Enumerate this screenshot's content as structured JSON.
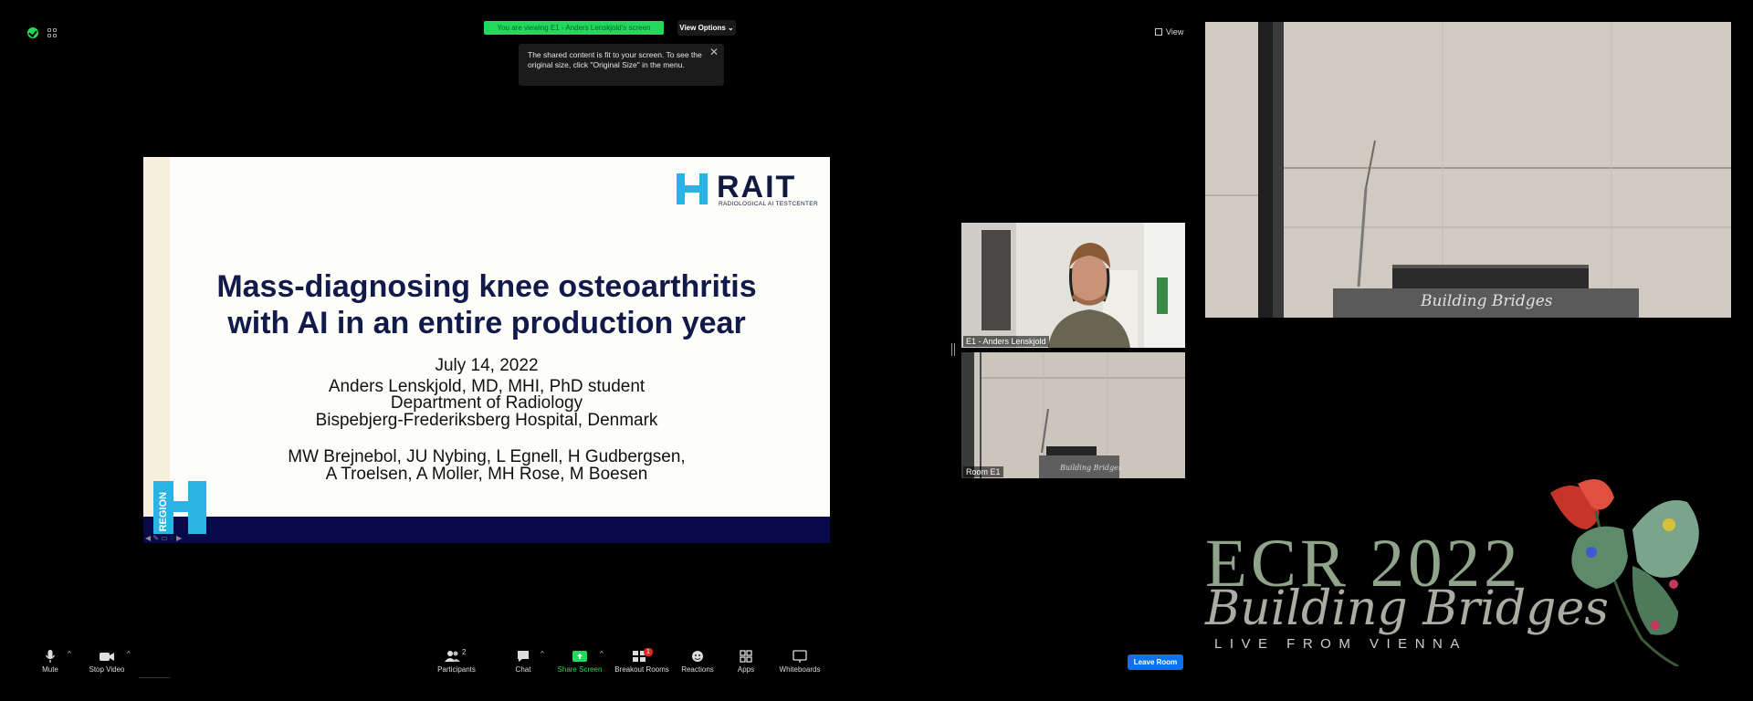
{
  "top_bar": {
    "viewing_banner": "You are viewing E1 - Anders Lenskjold's screen",
    "view_options": "View Options",
    "view_options_caret": "⌄",
    "view_button": "View"
  },
  "fit_notice": {
    "text": "The shared content is fit to your screen. To see the original size, click \"Original Size\" in the menu.",
    "close": "✕"
  },
  "slide": {
    "logo_word": "RAIT",
    "logo_subtitle": "RADIOLOGICAL AI TESTCENTER",
    "title_line1": "Mass-diagnosing knee osteoarthritis",
    "title_line2": "with AI in an entire production year",
    "date": "July 14, 2022",
    "presenter": "Anders Lenskjold, MD, MHI, PhD student",
    "department": "Department of Radiology",
    "hospital": "Bispebjerg-Frederiksberg Hospital, Denmark",
    "authors_line1": "MW Brejnebol, JU Nybing, L Egnell, H Gudbergsen,",
    "authors_line2": "A Troelsen, A Moller, MH Rose, M Boesen",
    "region_label": "REGION",
    "controls": "◀ ✎ ▭ ◌ ▶"
  },
  "video": {
    "speaker_label": "E1 - Anders Lenskjold",
    "room_label": "Room E1",
    "podium_text": "Building Bridges"
  },
  "branding": {
    "ecr_title": "ECR 2022",
    "ecr_subtitle": "Building Bridges",
    "ecr_live": "LIVE FROM VIENNA"
  },
  "toolbar": {
    "mute": "Mute",
    "stop_video": "Stop Video",
    "participants": "Participants",
    "participants_count": "2",
    "chat": "Chat",
    "share_screen": "Share Screen",
    "breakout_rooms": "Breakout Rooms",
    "breakout_badge": "1",
    "reactions": "Reactions",
    "apps": "Apps",
    "whiteboards": "Whiteboards",
    "leave_room": "Leave Room",
    "caret": "^"
  },
  "colors": {
    "banner_green": "#23d95c",
    "leave_blue": "#0e72ed",
    "slide_footer": "#08094a",
    "rait_cyan": "#2ab3e4"
  }
}
